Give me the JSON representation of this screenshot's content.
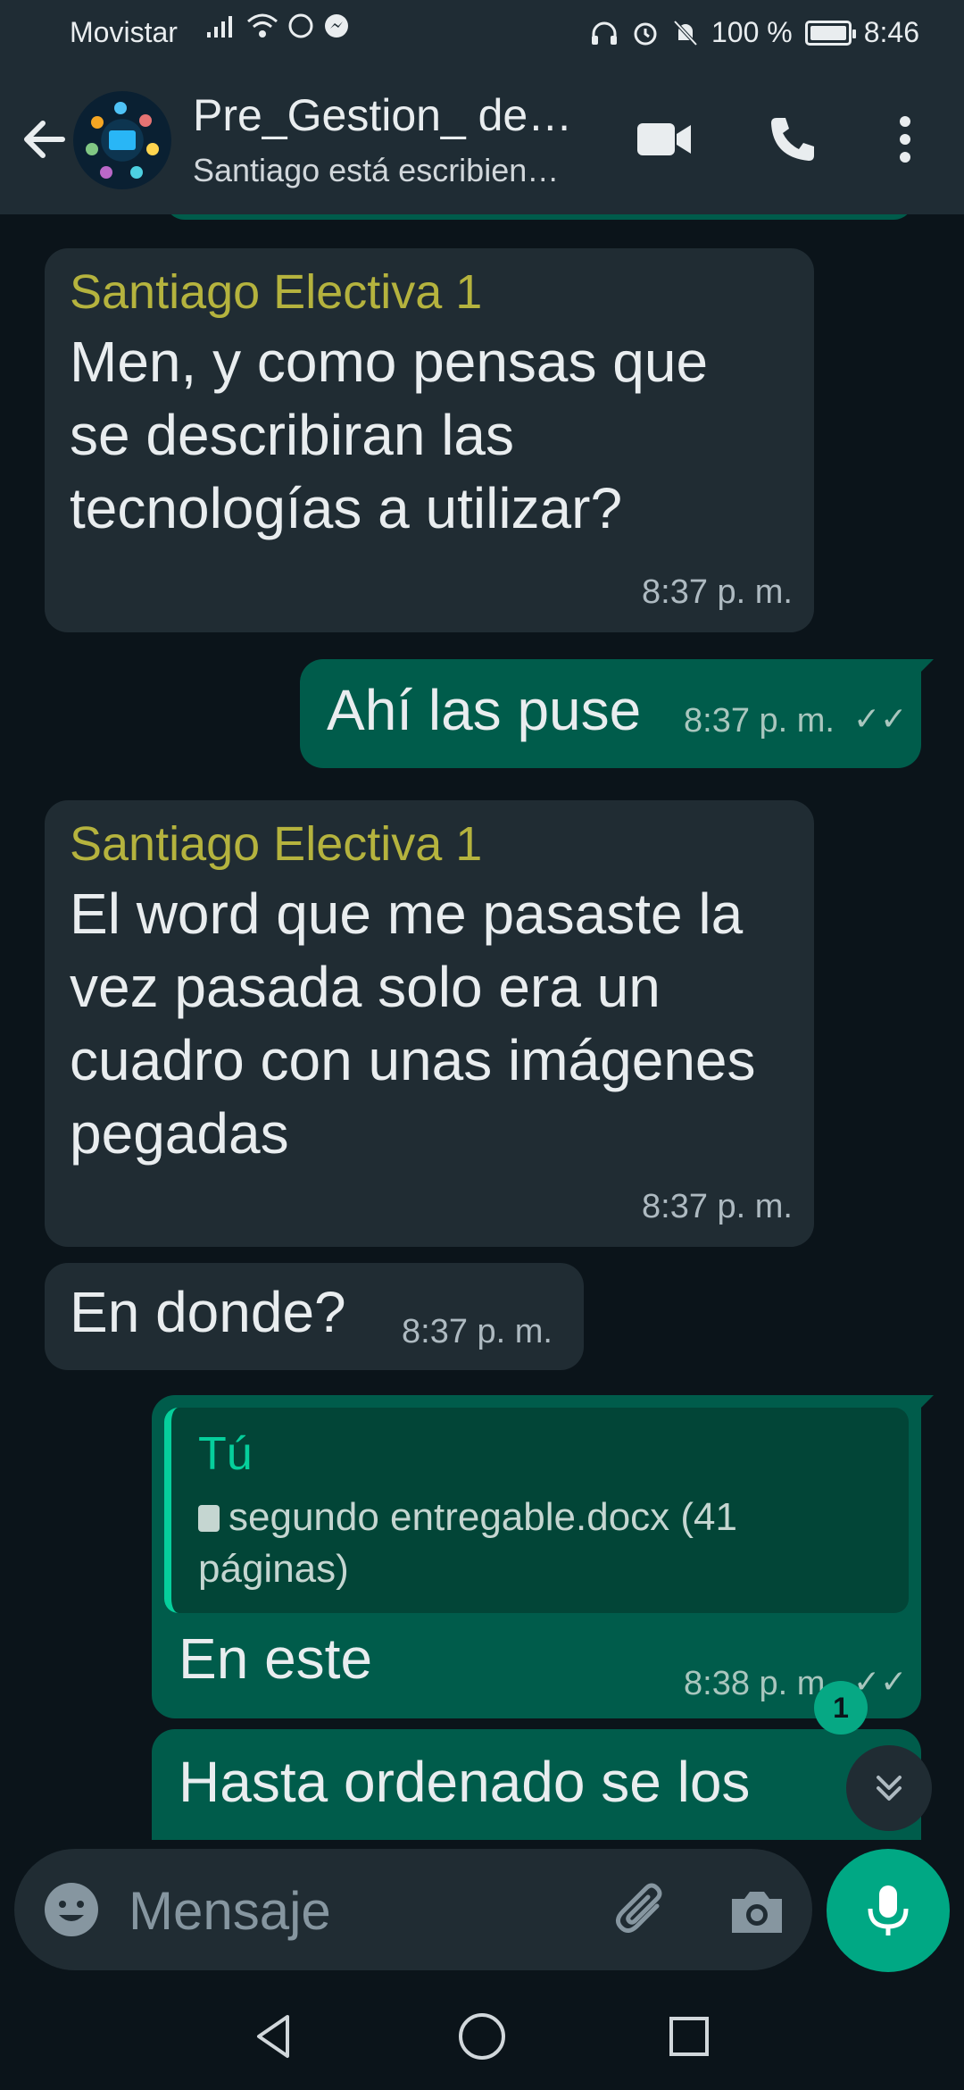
{
  "status_bar": {
    "carrier": "Movistar",
    "battery": "100 %",
    "battery_level": 1.0,
    "time": "8:46"
  },
  "header": {
    "title": "Pre_Gestion_ de…",
    "subtitle": "Santiago está escribien…"
  },
  "messages": [
    {
      "direction": "in",
      "sender": "Santiago Electiva 1",
      "text": "Men, y como pensas que se describiran las tecnologías a utilizar?",
      "time": "8:37 p. m."
    },
    {
      "direction": "out",
      "text": "Ahí las puse",
      "time": "8:37 p. m.",
      "ticks": "✓✓"
    },
    {
      "direction": "in",
      "sender": "Santiago Electiva 1",
      "text": "El word que me pasaste la vez pasada solo era un cuadro con unas imágenes pegadas",
      "time": "8:37 p. m."
    },
    {
      "direction": "in",
      "text": "En donde?",
      "time": "8:37 p. m."
    },
    {
      "direction": "out",
      "quote": {
        "author": "Tú",
        "file": "segundo entregable.docx (41 páginas)"
      },
      "text": "En este",
      "time": "8:38 p. m.",
      "ticks": "✓✓"
    },
    {
      "direction": "out",
      "text": "Hasta ordenado se los"
    }
  ],
  "unread_count": "1",
  "composer": {
    "placeholder": "Mensaje"
  },
  "colors": {
    "incoming_bubble": "#202c33",
    "outgoing_bubble": "#005c4b",
    "accent": "#00a884",
    "sender_name": "#b5b33e"
  },
  "icons": [
    "back-arrow-icon",
    "video-call-icon",
    "phone-icon",
    "more-vertical-icon",
    "emoji-icon",
    "attach-icon",
    "camera-icon",
    "mic-icon",
    "double-chevron-down-icon",
    "nav-back-icon",
    "nav-home-icon",
    "nav-recents-icon"
  ]
}
